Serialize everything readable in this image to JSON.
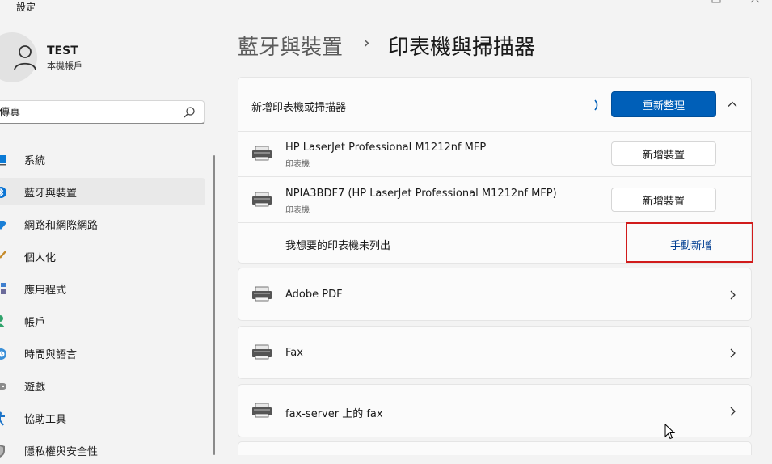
{
  "window": {
    "app_title": "設定"
  },
  "account": {
    "name": "TEST",
    "type": "本機帳戶"
  },
  "search": {
    "value": "傳真"
  },
  "nav": [
    {
      "label": "系統",
      "icon": "system-icon"
    },
    {
      "label": "藍牙與裝置",
      "icon": "bluetooth-icon",
      "selected": true
    },
    {
      "label": "網路和網際網路",
      "icon": "wifi-icon"
    },
    {
      "label": "個人化",
      "icon": "brush-icon"
    },
    {
      "label": "應用程式",
      "icon": "apps-icon"
    },
    {
      "label": "帳戶",
      "icon": "person-icon"
    },
    {
      "label": "時間與語言",
      "icon": "clock-globe-icon"
    },
    {
      "label": "遊戲",
      "icon": "gamepad-icon"
    },
    {
      "label": "協助工具",
      "icon": "accessibility-icon"
    },
    {
      "label": "隱私權與安全性",
      "icon": "shield-icon"
    }
  ],
  "breadcrumb": {
    "parent": "藍牙與裝置",
    "separator": "›",
    "current": "印表機與掃描器"
  },
  "add_section": {
    "title": "新增印表機或掃描器",
    "refresh_label": "重新整理",
    "devices": [
      {
        "name": "HP LaserJet Professional M1212nf MFP",
        "type": "印表機",
        "button": "新增裝置"
      },
      {
        "name": "NPIA3BDF7 (HP LaserJet Professional M1212nf MFP)",
        "type": "印表機",
        "button": "新增裝置"
      }
    ],
    "not_listed_label": "我想要的印表機未列出",
    "manual_add_label": "手動新增"
  },
  "printers": [
    {
      "name": "Adobe PDF"
    },
    {
      "name": "Fax"
    },
    {
      "name": "fax-server 上的 fax"
    }
  ],
  "colors": {
    "accent": "#005fb8",
    "highlight": "#d11b1b"
  }
}
